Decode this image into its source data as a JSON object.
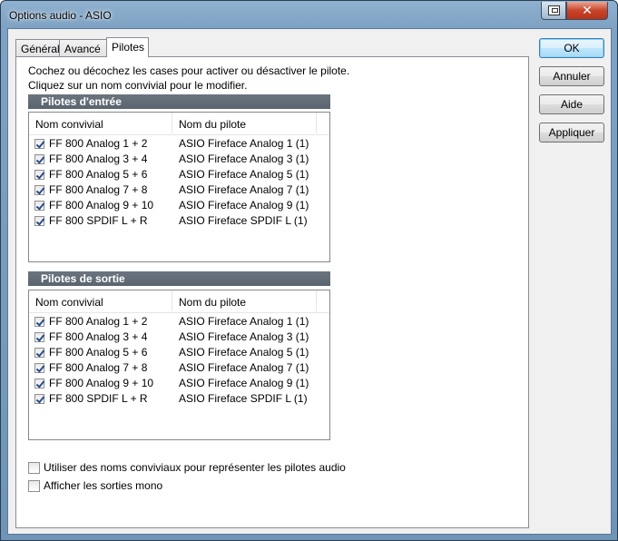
{
  "window": {
    "title": "Options audio - ASIO"
  },
  "tabs": [
    {
      "label": "Général"
    },
    {
      "label": "Avancé"
    },
    {
      "label": "Pilotes"
    }
  ],
  "instructions": {
    "line1": "Cochez ou décochez les cases pour activer ou désactiver le pilote.",
    "line2": "Cliquez sur un nom convivial pour le modifier."
  },
  "input_group": {
    "header": "Pilotes d'entrée",
    "col_name": "Nom convivial",
    "col_driver": "Nom du pilote",
    "rows": [
      {
        "name": "FF 800 Analog 1 + 2",
        "driver": "ASIO Fireface Analog 1 (1)",
        "checked": true
      },
      {
        "name": "FF 800 Analog 3 + 4",
        "driver": "ASIO Fireface Analog 3 (1)",
        "checked": true
      },
      {
        "name": "FF 800 Analog 5 + 6",
        "driver": "ASIO Fireface Analog 5 (1)",
        "checked": true
      },
      {
        "name": "FF 800 Analog 7 + 8",
        "driver": "ASIO Fireface Analog 7 (1)",
        "checked": true
      },
      {
        "name": "FF 800 Analog 9 + 10",
        "driver": "ASIO Fireface Analog 9 (1)",
        "checked": true
      },
      {
        "name": "FF 800 SPDIF L + R",
        "driver": "ASIO Fireface SPDIF L (1)",
        "checked": true
      }
    ]
  },
  "output_group": {
    "header": "Pilotes de sortie",
    "col_name": "Nom convivial",
    "col_driver": "Nom du pilote",
    "rows": [
      {
        "name": "FF 800 Analog 1 + 2",
        "driver": "ASIO Fireface Analog 1 (1)",
        "checked": true
      },
      {
        "name": "FF 800 Analog 3 + 4",
        "driver": "ASIO Fireface Analog 3 (1)",
        "checked": true
      },
      {
        "name": "FF 800 Analog 5 + 6",
        "driver": "ASIO Fireface Analog 5 (1)",
        "checked": true
      },
      {
        "name": "FF 800 Analog 7 + 8",
        "driver": "ASIO Fireface Analog 7 (1)",
        "checked": true
      },
      {
        "name": "FF 800 Analog 9 + 10",
        "driver": "ASIO Fireface Analog 9 (1)",
        "checked": true
      },
      {
        "name": "FF 800 SPDIF L + R",
        "driver": "ASIO Fireface SPDIF L (1)",
        "checked": true
      }
    ]
  },
  "options": {
    "friendly_names": {
      "label": "Utiliser des noms conviviaux pour représenter les pilotes audio",
      "checked": false
    },
    "mono_outputs": {
      "label": "Afficher les sorties mono",
      "checked": false
    }
  },
  "buttons": {
    "ok": "OK",
    "cancel": "Annuler",
    "help": "Aide",
    "apply": "Appliquer"
  }
}
